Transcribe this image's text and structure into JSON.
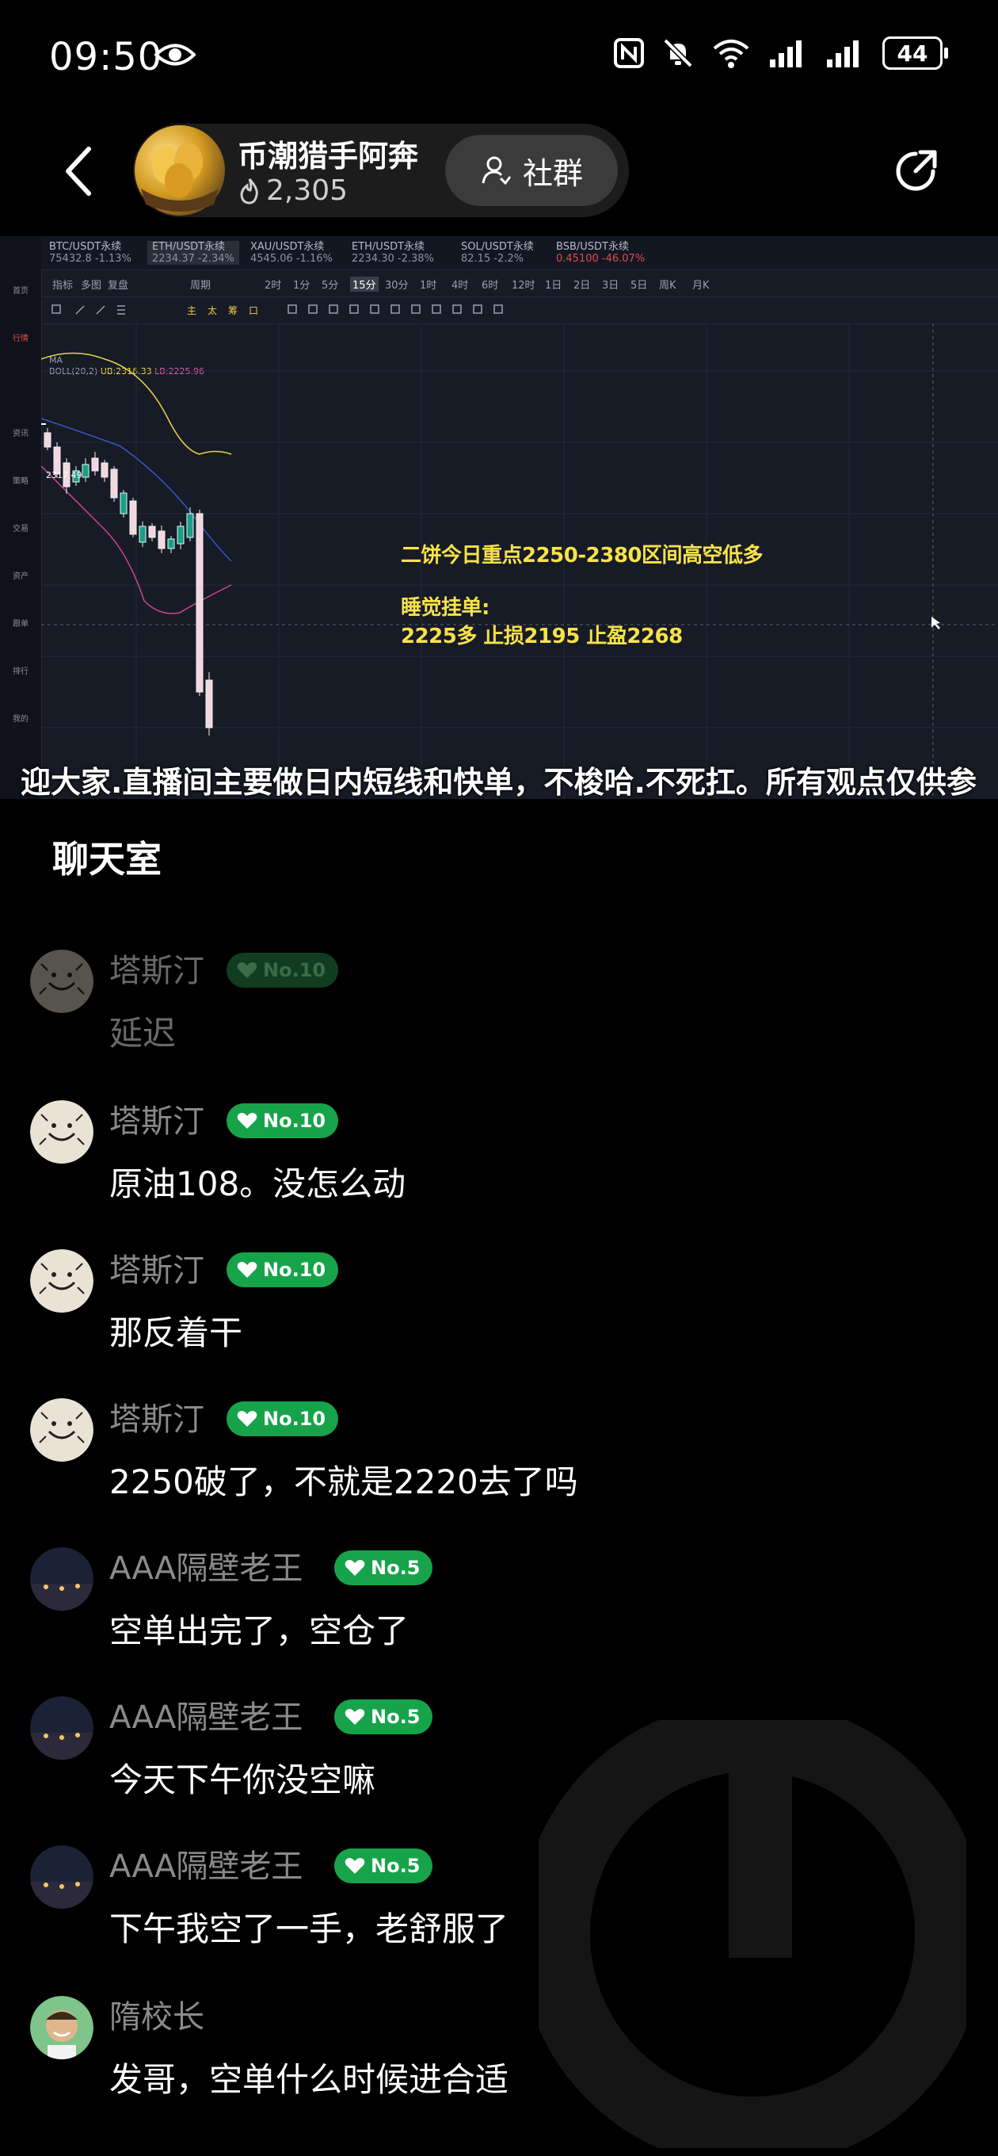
{
  "status_bar": {
    "time": "09:50",
    "battery": "44"
  },
  "header": {
    "host_name": "币潮猎手阿奔",
    "fan_count": "2,305",
    "group_button": "社群"
  },
  "stream": {
    "tabs": [
      {
        "pair": "BTC/USDT永续",
        "price": "75432.8",
        "change": "-1.13%"
      },
      {
        "pair": "ETH/USDT永续",
        "price": "2234.37",
        "change": "-2.34%"
      },
      {
        "pair": "XAU/USDT永续",
        "price": "4545.06",
        "change": "-1.16%"
      },
      {
        "pair": "ETH/USDT永续",
        "price": "2234.30",
        "change": "-2.38%"
      },
      {
        "pair": "SOL/USDT永续",
        "price": "82.15",
        "change": "-2.2%"
      },
      {
        "pair": "BSB/USDT永续",
        "price": "0.45100",
        "change": "-46.07%"
      }
    ],
    "toolbar_items": [
      "指标",
      "多图",
      "复盘",
      "周期",
      "2时",
      "1分",
      "5分",
      "15分",
      "30分",
      "1时",
      "4时",
      "6时",
      "12时",
      "1日",
      "2日",
      "3日",
      "5日",
      "周K",
      "月K"
    ],
    "selected_interval": "15分",
    "indicator_line1": "MA",
    "indicator_line2": "BOLL(20,2)",
    "ub_label": "UB:2316.33",
    "lb_label": "LB:2225.96",
    "price_label": "2317.49",
    "left_labels": [
      "首页",
      "行情",
      "资讯",
      "策略",
      "交易",
      "资产",
      "跟单",
      "排行",
      "我的"
    ],
    "note_line1": "二饼今日重点2250-2380区间高空低多",
    "note_line2": "睡觉挂单:",
    "note_line3": "2225多 止损2195  止盈2268",
    "ticker": "迎大家.直播间主要做日内短线和快单，不梭哈.不死扛。所有观点仅供参"
  },
  "chat": {
    "title": "聊天室",
    "messages": [
      {
        "user": "塔斯汀",
        "level": "No.10",
        "text": "延迟",
        "avatar": "doodle",
        "faded": true
      },
      {
        "user": "塔斯汀",
        "level": "No.10",
        "text": "原油108。没怎么动",
        "avatar": "doodle",
        "faded": false
      },
      {
        "user": "塔斯汀",
        "level": "No.10",
        "text": "那反着干",
        "avatar": "doodle",
        "faded": false
      },
      {
        "user": "塔斯汀",
        "level": "No.10",
        "text": "2250破了，不就是2220去了吗",
        "avatar": "doodle",
        "faded": false
      },
      {
        "user": "AAA隔壁老王",
        "level": "No.5",
        "text": "空单出完了，空仓了",
        "avatar": "night-city",
        "faded": false
      },
      {
        "user": "AAA隔壁老王",
        "level": "No.5",
        "text": "今天下午你没空嘛",
        "avatar": "night-city",
        "faded": false
      },
      {
        "user": "AAA隔壁老王",
        "level": "No.5",
        "text": "下午我空了一手，老舒服了",
        "avatar": "night-city",
        "faded": false
      },
      {
        "user": "隋校长",
        "level": "",
        "text": "发哥，空单什么时候进合适",
        "avatar": "portrait",
        "faded": false
      }
    ]
  }
}
